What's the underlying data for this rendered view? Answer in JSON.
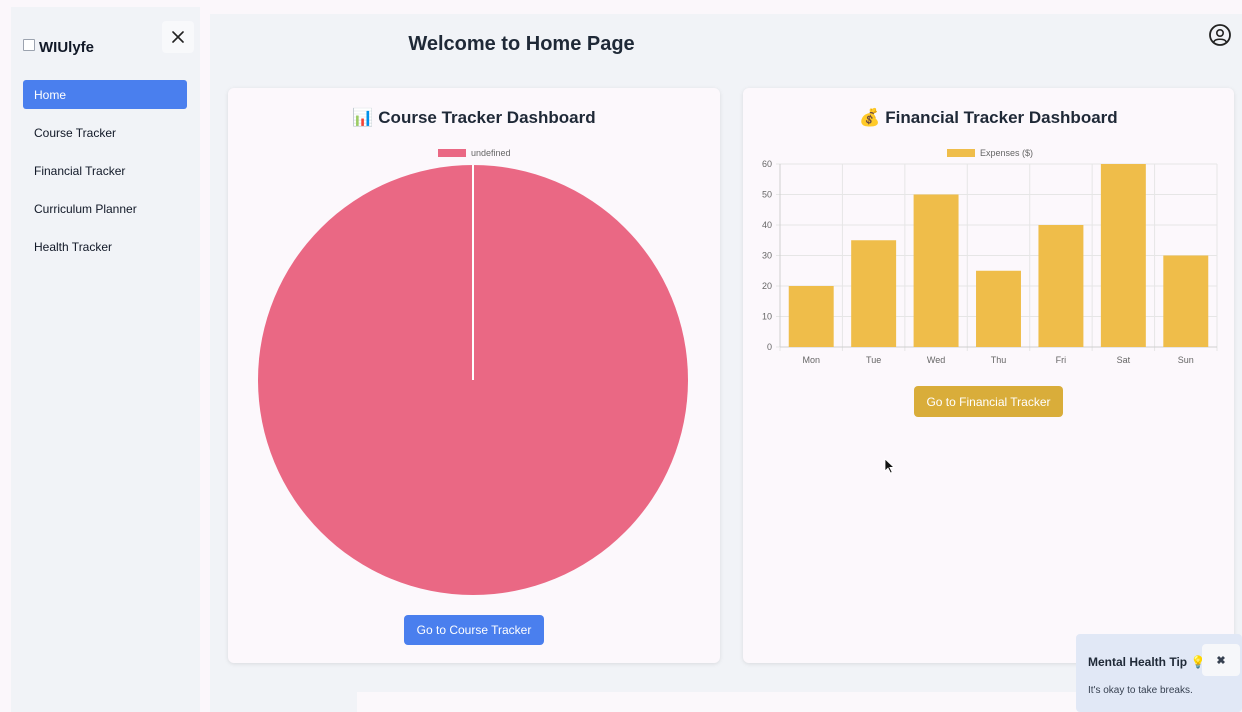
{
  "sidebar": {
    "brand": "WIUlyfe",
    "close_icon": "close-icon",
    "items": [
      {
        "label": "Home",
        "active": true
      },
      {
        "label": "Course Tracker",
        "active": false
      },
      {
        "label": "Financial Tracker",
        "active": false
      },
      {
        "label": "Curriculum Planner",
        "active": false
      },
      {
        "label": "Health Tracker",
        "active": false
      }
    ]
  },
  "header": {
    "title": "Welcome to Home Page",
    "profile_icon": "user-circle-icon"
  },
  "course_card": {
    "title": "📊 Course Tracker Dashboard",
    "button_label": "Go to Course Tracker"
  },
  "financial_card": {
    "title": "💰 Financial Tracker Dashboard",
    "button_label": "Go to Financial Tracker"
  },
  "toast": {
    "title": "Mental Health Tip 💡",
    "close_label": "✖",
    "message": "It's okay to take breaks."
  },
  "colors": {
    "accent": "#4a7fee",
    "pie": "#ea6884",
    "bar": "#efbd4a",
    "fin_button": "#d9ad3a"
  },
  "chart_data": [
    {
      "type": "pie",
      "legend": [
        "undefined"
      ],
      "values": [
        100
      ],
      "colors": [
        "#ea6884"
      ]
    },
    {
      "type": "bar",
      "categories": [
        "Mon",
        "Tue",
        "Wed",
        "Thu",
        "Fri",
        "Sat",
        "Sun"
      ],
      "series": [
        {
          "name": "Expenses ($)",
          "values": [
            20,
            35,
            50,
            25,
            40,
            60,
            30
          ]
        }
      ],
      "ylim": [
        0,
        60
      ],
      "yticks": [
        0,
        10,
        20,
        30,
        40,
        50,
        60
      ],
      "grid": true,
      "legend_position": "top",
      "colors": [
        "#efbd4a"
      ]
    }
  ]
}
